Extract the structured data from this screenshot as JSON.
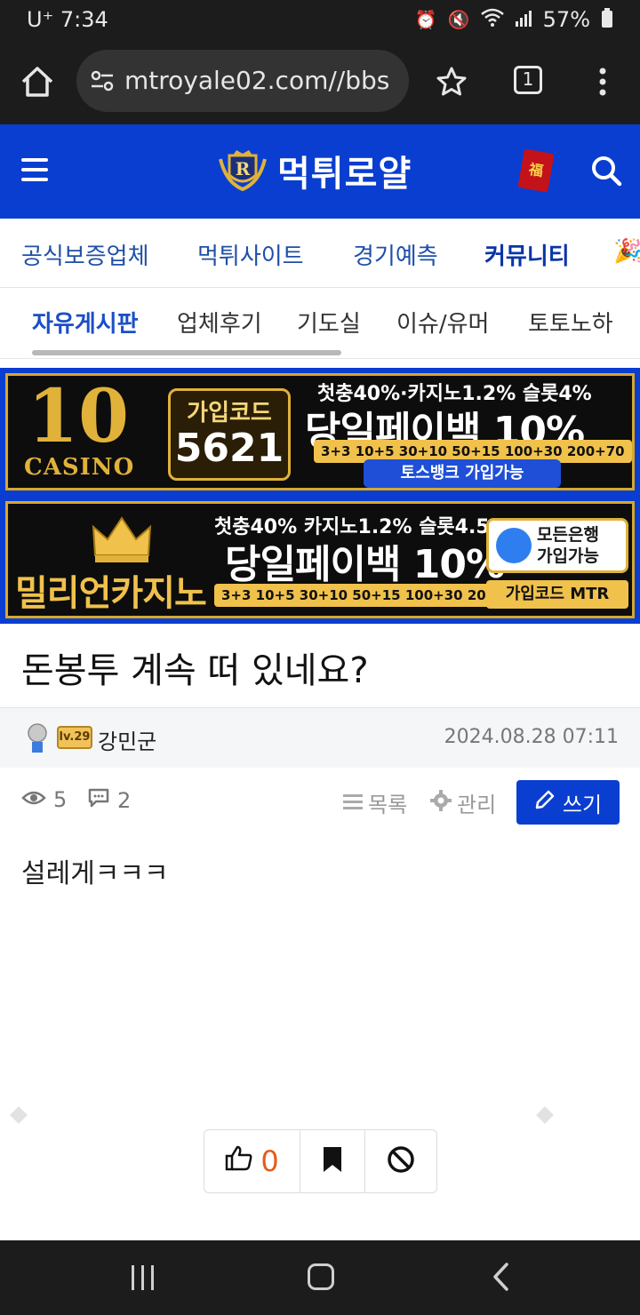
{
  "status_bar": {
    "carrier_time": "U⁺ 7:34",
    "battery": "57%"
  },
  "browser": {
    "url": "mtroyale02.com//bbs",
    "tab_count": "1"
  },
  "site": {
    "brand": "먹튀로얄",
    "envelope_char": "福"
  },
  "main_nav": [
    {
      "label": "공식보증업체"
    },
    {
      "label": "먹튀사이트"
    },
    {
      "label": "경기예측"
    },
    {
      "label": "커뮤니티"
    }
  ],
  "sub_nav": [
    {
      "label": "자유게시판"
    },
    {
      "label": "업체후기"
    },
    {
      "label": "기도실"
    },
    {
      "label": "이슈/유머"
    },
    {
      "label": "토토노하"
    }
  ],
  "banners": {
    "b1": {
      "logo_num": "10",
      "logo_text": "CASINO",
      "code_label": "가입코드",
      "code_value": "5621",
      "line1": "첫충40%·카지노1.2% 슬롯4%",
      "line2": "당일페이백 10%",
      "rates": "3+3 10+5 30+10 50+15 100+30 200+70",
      "toss": "토스뱅크 가입가능"
    },
    "b2": {
      "logo_text": "밀리언카지노",
      "line1": "첫충40% 카지노1.2% 슬롯4.5%",
      "line2": "당일페이백 10%",
      "rates": "3+3 10+5 30+10 50+15 100+30 200+70",
      "bank_line1": "모든은행",
      "bank_line2": "가입가능",
      "code": "가입코드 MTR"
    }
  },
  "post": {
    "title": "돈봉투 계속 떠 있네요?",
    "level": "lv.29",
    "author": "강민군",
    "date": "2024.08.28 07:11",
    "views": "5",
    "comments": "2",
    "list_label": "목록",
    "manage_label": "관리",
    "write_label": "쓰기",
    "body": "설레게ㅋㅋㅋ",
    "likes": "0"
  },
  "colors": {
    "brand_blue": "#0a3ed0",
    "gold": "#f0c14b",
    "like_orange": "#e55b1a"
  }
}
